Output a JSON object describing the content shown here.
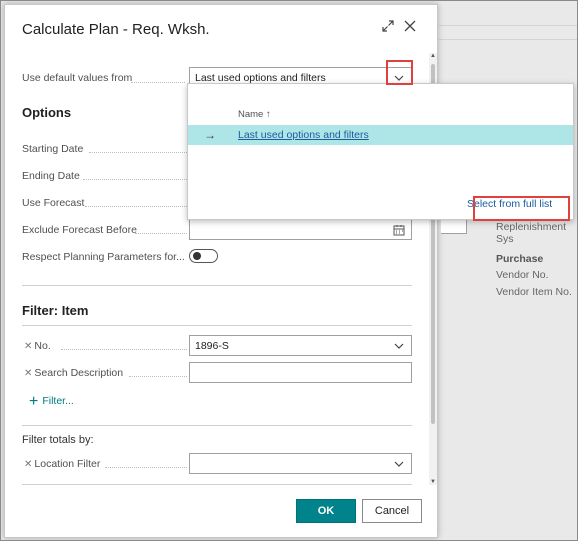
{
  "dialog": {
    "title": "Calculate Plan - Req. Wksh.",
    "use_default_label": "Use default values from",
    "use_default_value": "Last used options and filters"
  },
  "options": {
    "header": "Options",
    "starting_date_label": "Starting Date",
    "ending_date_label": "Ending Date",
    "use_forecast_label": "Use Forecast",
    "exclude_forecast_label": "Exclude Forecast Before",
    "respect_planning_label": "Respect Planning Parameters for..."
  },
  "filter_item": {
    "header": "Filter: Item",
    "no_label": "No.",
    "no_value": "1896-S",
    "search_desc_label": "Search Description",
    "search_desc_value": "",
    "add_filter": "Filter..."
  },
  "filter_totals": {
    "header": "Filter totals by:",
    "location_label": "Location Filter",
    "location_value": ""
  },
  "buttons": {
    "ok": "OK",
    "cancel": "Cancel"
  },
  "dropdown": {
    "column_header": "Name",
    "sort_indicator": "↑",
    "rows": [
      "Last used options and filters"
    ],
    "select_full_list": "Select from full list"
  },
  "background_page": {
    "replenishment": "Replenishment Sys",
    "purchase_header": "Purchase",
    "vendor_no": "Vendor No.",
    "vendor_item_no": "Vendor Item No."
  },
  "icons": {
    "expand": "expand-icon",
    "close": "close-icon",
    "chevron": "chevron-down-icon",
    "calendar": "calendar-icon",
    "arrow": "arrow-right-icon",
    "plus": "plus-icon"
  },
  "colors": {
    "accent": "#00838a",
    "selection": "#aee6e8",
    "link": "#1b5b9e",
    "highlight_box": "#e0413f"
  }
}
